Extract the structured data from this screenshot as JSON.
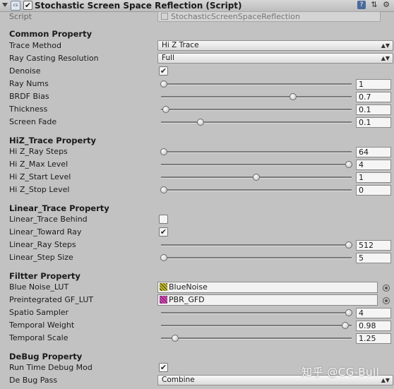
{
  "header": {
    "component_title": "Stochastic Screen Space Reflection (Script)",
    "enabled_check": "✔",
    "icons": [
      "foldout-arrow-icon",
      "script-icon",
      "help-icon",
      "preset-icon",
      "gear-icon"
    ]
  },
  "script": {
    "label": "Script",
    "value": "StochasticScreenSpaceReflection"
  },
  "common": {
    "title": "Common Property",
    "trace_method": {
      "label": "Trace Method",
      "value": "Hi Z Trace"
    },
    "ray_casting_resolution": {
      "label": "Ray Casting Resolution",
      "value": "Full"
    },
    "denoise": {
      "label": "Denoise",
      "checked": true
    },
    "ray_nums": {
      "label": "Ray Nums",
      "value": "1",
      "fraction": 0.0
    },
    "brdf_bias": {
      "label": "BRDF Bias",
      "value": "0.7",
      "fraction": 0.7
    },
    "thickness": {
      "label": "Thickness",
      "value": "0.1",
      "fraction": 0.01
    },
    "screen_fade": {
      "label": "Screen Fade",
      "value": "0.1",
      "fraction": 0.2
    }
  },
  "hiz": {
    "title": "HiZ_Trace Property",
    "ray_steps": {
      "label": "Hi Z_Ray Steps",
      "value": "64",
      "fraction": 0.0
    },
    "max_level": {
      "label": "Hi Z_Max Level",
      "value": "4",
      "fraction": 1.0
    },
    "start_level": {
      "label": "Hi Z_Start Level",
      "value": "1",
      "fraction": 0.5
    },
    "stop_level": {
      "label": "Hi Z_Stop Level",
      "value": "0",
      "fraction": 0.0
    }
  },
  "linear": {
    "title": "Linear_Trace Property",
    "trace_behind": {
      "label": "Linear_Trace Behind",
      "checked": false
    },
    "toward_ray": {
      "label": "Linear_Toward Ray",
      "checked": true
    },
    "ray_steps": {
      "label": "Linear_Ray Steps",
      "value": "512",
      "fraction": 1.0
    },
    "step_size": {
      "label": "Linear_Step Size",
      "value": "5",
      "fraction": 0.0
    }
  },
  "filter": {
    "title": "Filtter Property",
    "blue_noise": {
      "label": "Blue Noise_LUT",
      "value": "BlueNoise",
      "color": "#c8c020"
    },
    "preintegrated": {
      "label": "Preintegrated GF_LUT",
      "value": "PBR_GFD",
      "color": "#e040c0"
    },
    "spatio_sampler": {
      "label": "Spatio Sampler",
      "value": "4",
      "fraction": 1.0
    },
    "temporal_weight": {
      "label": "Temporal Weight",
      "value": "0.98",
      "fraction": 0.98
    },
    "temporal_scale": {
      "label": "Temporal Scale",
      "value": "1.25",
      "fraction": 0.06
    }
  },
  "debug": {
    "title": "DeBug Property",
    "run_time": {
      "label": "Run Time Debug Mod",
      "checked": true
    },
    "pass": {
      "label": "De Bug Pass",
      "value": "Combine"
    }
  },
  "watermark": "知乎 @CG-Bull",
  "colors": {
    "panel_bg": "#c2c2c2",
    "field_bg": "#f5f5f5",
    "help_icon": "#4a6a9a"
  }
}
